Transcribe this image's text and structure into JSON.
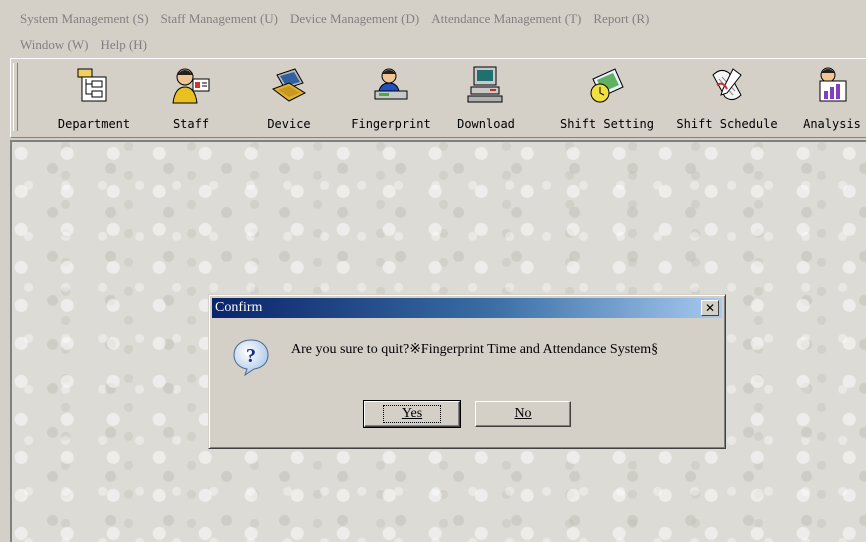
{
  "menu": {
    "row1": [
      "System Management (S)",
      "Staff Management (U)",
      "Device Management (D)",
      "Attendance Management (T)",
      "Report (R)"
    ],
    "row2": [
      "Window (W)",
      "Help (H)"
    ]
  },
  "toolbar": {
    "items": [
      {
        "label": "Department",
        "icon": "department-icon"
      },
      {
        "label": "Staff",
        "icon": "staff-icon"
      },
      {
        "label": "Device",
        "icon": "device-icon"
      },
      {
        "label": "Fingerprint",
        "icon": "fingerprint-icon"
      },
      {
        "label": "Download",
        "icon": "download-icon"
      },
      {
        "label": "Shift Setting",
        "icon": "shift-setting-icon"
      },
      {
        "label": "Shift Schedule",
        "icon": "shift-schedule-icon"
      },
      {
        "label": "Analysis",
        "icon": "analysis-icon"
      }
    ]
  },
  "dialog": {
    "title": "Confirm",
    "close_glyph": "✕",
    "icon": "question-icon",
    "message": "Are you sure to quit?※Fingerprint Time and Attendance System§",
    "yes_label": "Yes",
    "no_label": "No"
  },
  "colors": {
    "titlebar_start": "#0a246a",
    "titlebar_end": "#a6caf0",
    "face": "#d4d0c8",
    "menu_text": "#808080"
  }
}
